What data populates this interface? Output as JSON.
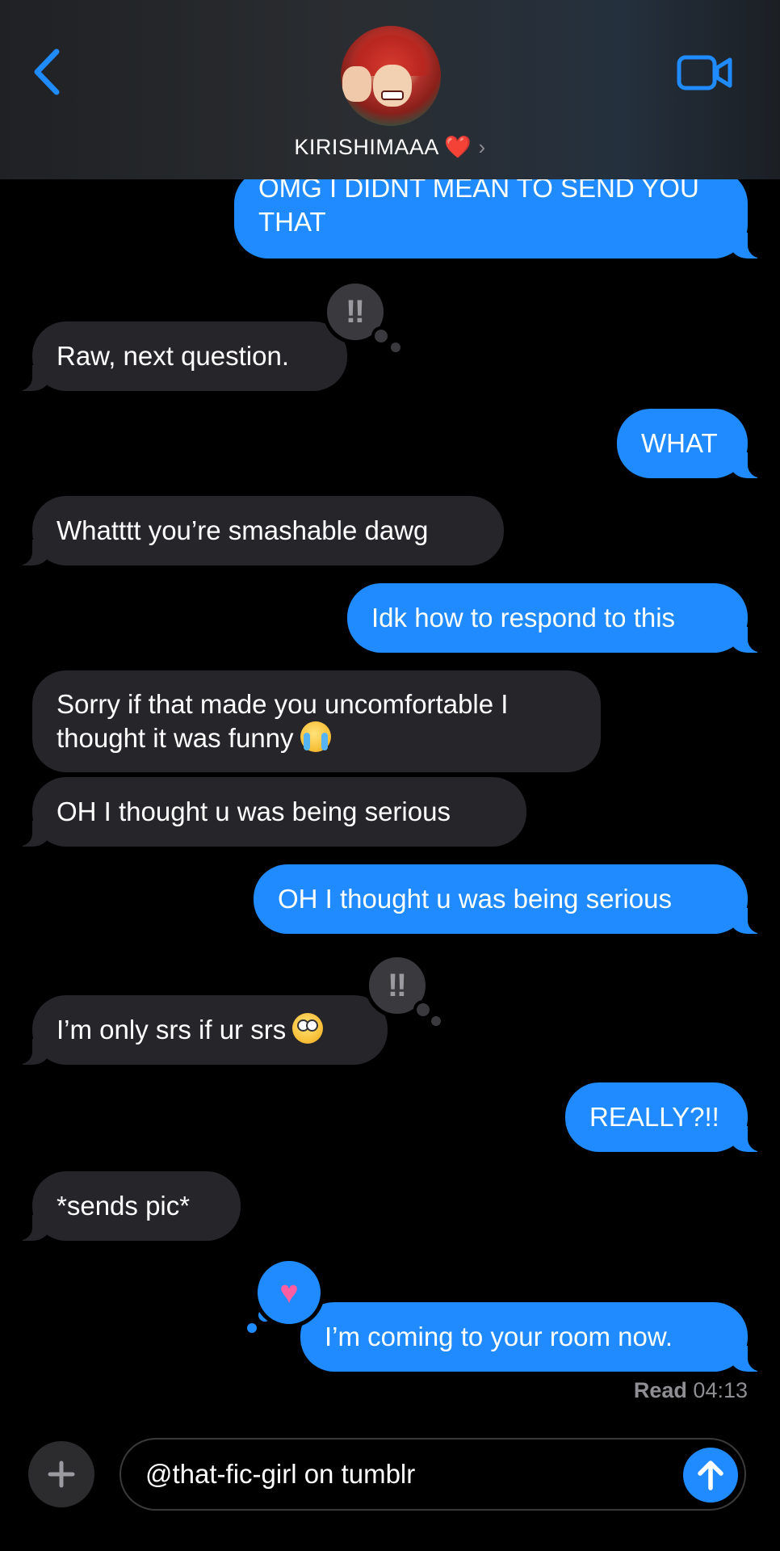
{
  "header": {
    "contact_name": "KIRISHIMAAA ❤️",
    "chevron": "›",
    "icons": {
      "back": "back-chevron-icon",
      "video": "video-camera-icon"
    }
  },
  "messages": [
    {
      "id": "m1",
      "from": "me",
      "lines": [
        "OMG I DIDNT MEAN TO SEND YOU",
        "THAT"
      ]
    },
    {
      "id": "m2",
      "from": "them",
      "text": "Raw, next question.",
      "tapback": "‼"
    },
    {
      "id": "m3",
      "from": "me",
      "text": "WHAT"
    },
    {
      "id": "m4",
      "from": "them",
      "text": "Whatttt you’re smashable dawg"
    },
    {
      "id": "m5",
      "from": "me",
      "text": "Idk how to respond to this"
    },
    {
      "id": "m6",
      "from": "them",
      "lines": [
        "Sorry if that made you uncomfortable I",
        "thought it was funny"
      ],
      "emoji": "loudly-crying-face"
    },
    {
      "id": "m7",
      "from": "them",
      "text": "OH I thought u was being serious"
    },
    {
      "id": "m8",
      "from": "me",
      "text": "OH I thought u was being serious"
    },
    {
      "id": "m9",
      "from": "them",
      "text": "I’m only srs if ur srs",
      "emoji": "face-with-rolling-eyes",
      "tapback": "‼"
    },
    {
      "id": "m10",
      "from": "me",
      "text": "REALLY?!!"
    },
    {
      "id": "m11",
      "from": "them",
      "text": "*sends pic*"
    },
    {
      "id": "m12",
      "from": "me",
      "text": "I’m coming to your room now.",
      "tapback": "♥"
    }
  ],
  "read_receipt": {
    "label": "Read",
    "time": "04:13"
  },
  "composer": {
    "value": "@that-fic-girl on tumblr",
    "icons": {
      "plus": "plus-icon",
      "send": "send-arrow-up-icon"
    }
  },
  "colors": {
    "outgoing": "#1f8bff",
    "incoming": "#26252a",
    "background": "#000000",
    "heart": "#ff5fa2"
  }
}
